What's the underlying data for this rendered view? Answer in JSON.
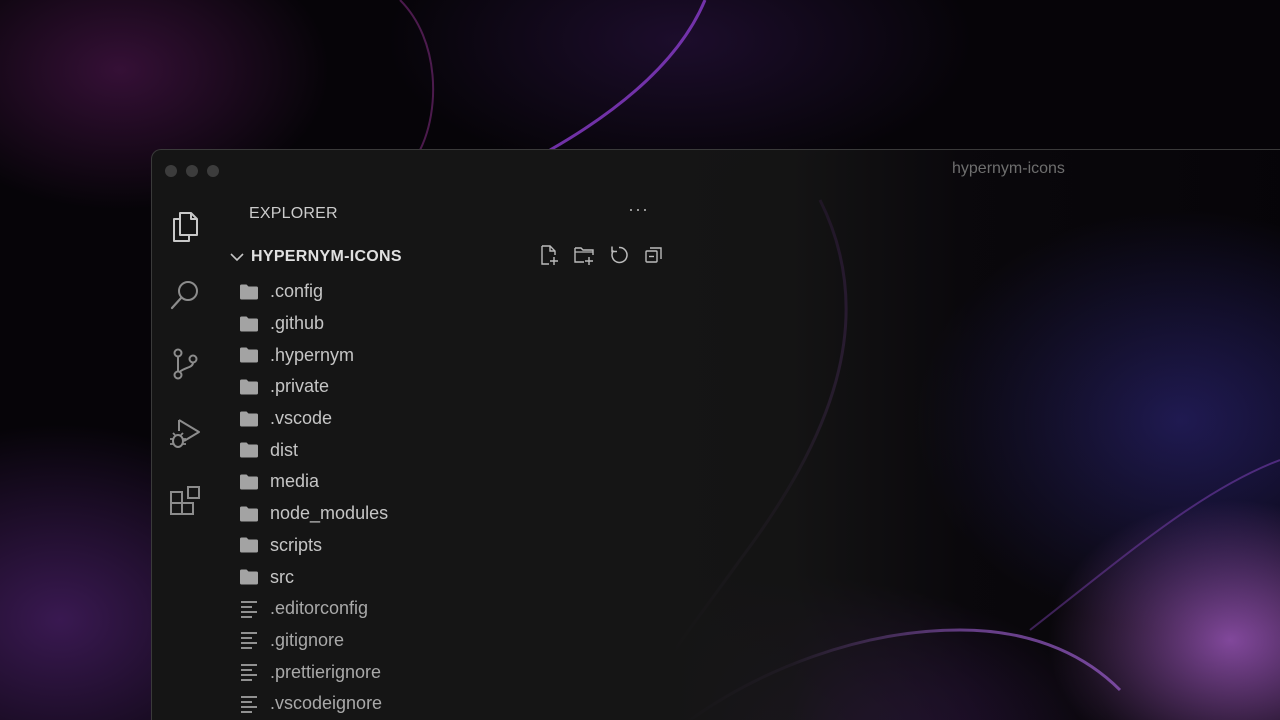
{
  "window": {
    "title": "hypernym-icons"
  },
  "activity_bar": {
    "items": [
      {
        "icon": "files-icon"
      },
      {
        "icon": "search-icon"
      },
      {
        "icon": "source-control-icon"
      },
      {
        "icon": "run-debug-icon"
      },
      {
        "icon": "extensions-icon"
      }
    ]
  },
  "sidebar": {
    "header": "EXPLORER",
    "more_actions": "···",
    "root": {
      "label": "HYPERNYM-ICONS",
      "actions": [
        "new-file-icon",
        "new-folder-icon",
        "refresh-icon",
        "collapse-all-icon"
      ]
    },
    "tree": [
      {
        "type": "folder",
        "label": ".config"
      },
      {
        "type": "folder",
        "label": ".github"
      },
      {
        "type": "folder",
        "label": ".hypernym"
      },
      {
        "type": "folder",
        "label": ".private"
      },
      {
        "type": "folder",
        "label": ".vscode"
      },
      {
        "type": "folder",
        "label": "dist"
      },
      {
        "type": "folder",
        "label": "media"
      },
      {
        "type": "folder",
        "label": "node_modules"
      },
      {
        "type": "folder",
        "label": "scripts"
      },
      {
        "type": "folder",
        "label": "src"
      },
      {
        "type": "file",
        "label": ".editorconfig"
      },
      {
        "type": "file",
        "label": ".gitignore"
      },
      {
        "type": "file",
        "label": ".prettierignore"
      },
      {
        "type": "file",
        "label": ".vscodeignore"
      }
    ]
  },
  "colors": {
    "window_bg": "#151515",
    "text_primary": "#c5c5c5",
    "icon": "#8c8c8c",
    "accent_wallpaper": "#b05ce6"
  }
}
